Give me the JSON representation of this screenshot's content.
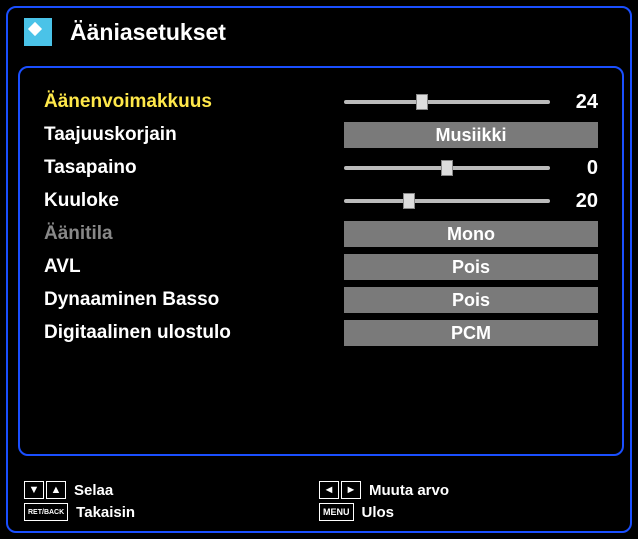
{
  "header": {
    "title": "Ääniasetukset"
  },
  "rows": [
    {
      "label": "Äänenvoimakkuus",
      "type": "slider",
      "value": 24,
      "min": 0,
      "max": 63,
      "state": "active"
    },
    {
      "label": "Taajuuskorjain",
      "type": "select",
      "value": "Musiikki",
      "state": "normal"
    },
    {
      "label": "Tasapaino",
      "type": "slider",
      "value": 0,
      "min": -31,
      "max": 31,
      "state": "normal"
    },
    {
      "label": "Kuuloke",
      "type": "slider",
      "value": 20,
      "min": 0,
      "max": 63,
      "state": "normal"
    },
    {
      "label": "Äänitila",
      "type": "select",
      "value": "Mono",
      "state": "dim"
    },
    {
      "label": "AVL",
      "type": "select",
      "value": "Pois",
      "state": "normal"
    },
    {
      "label": "Dynaaminen Basso",
      "type": "select",
      "value": "Pois",
      "state": "normal"
    },
    {
      "label": "Digitaalinen ulostulo",
      "type": "select",
      "value": "PCM",
      "state": "normal"
    }
  ],
  "footer": {
    "navigate": "Selaa",
    "back": "Takaisin",
    "change": "Muuta arvo",
    "exit": "Ulos",
    "back_key": "RET/BACK",
    "menu_key": "MENU"
  }
}
